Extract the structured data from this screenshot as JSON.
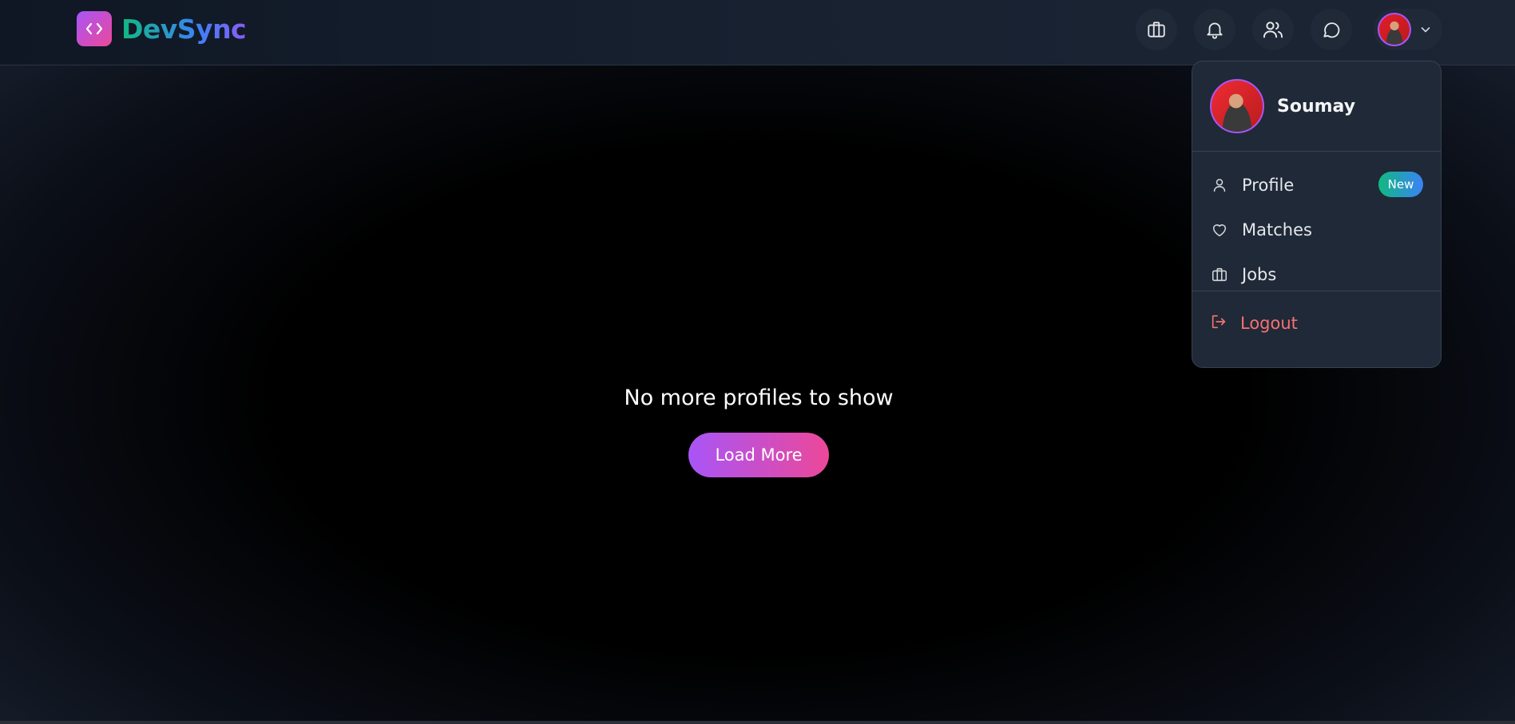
{
  "app": {
    "name": "DevSync",
    "brand_colors": {
      "logo_gradient": [
        "#a855f7",
        "#ec4899"
      ],
      "wordmark_gradient": [
        "#10b981",
        "#3b82f6",
        "#8b5cf6"
      ]
    }
  },
  "navbar": {
    "icons": [
      {
        "name": "briefcase-icon"
      },
      {
        "name": "bell-icon"
      },
      {
        "name": "users-icon"
      },
      {
        "name": "chat-bubble-icon"
      }
    ]
  },
  "user_menu": {
    "name": "Soumay",
    "items": [
      {
        "label": "Profile",
        "icon": "user-icon",
        "badge": "New"
      },
      {
        "label": "Matches",
        "icon": "heart-icon"
      },
      {
        "label": "Jobs",
        "icon": "briefcase-icon"
      }
    ],
    "logout_label": "Logout",
    "logout_color": "#f87171"
  },
  "main": {
    "empty_message": "No more profiles to show",
    "load_more_label": "Load More"
  }
}
